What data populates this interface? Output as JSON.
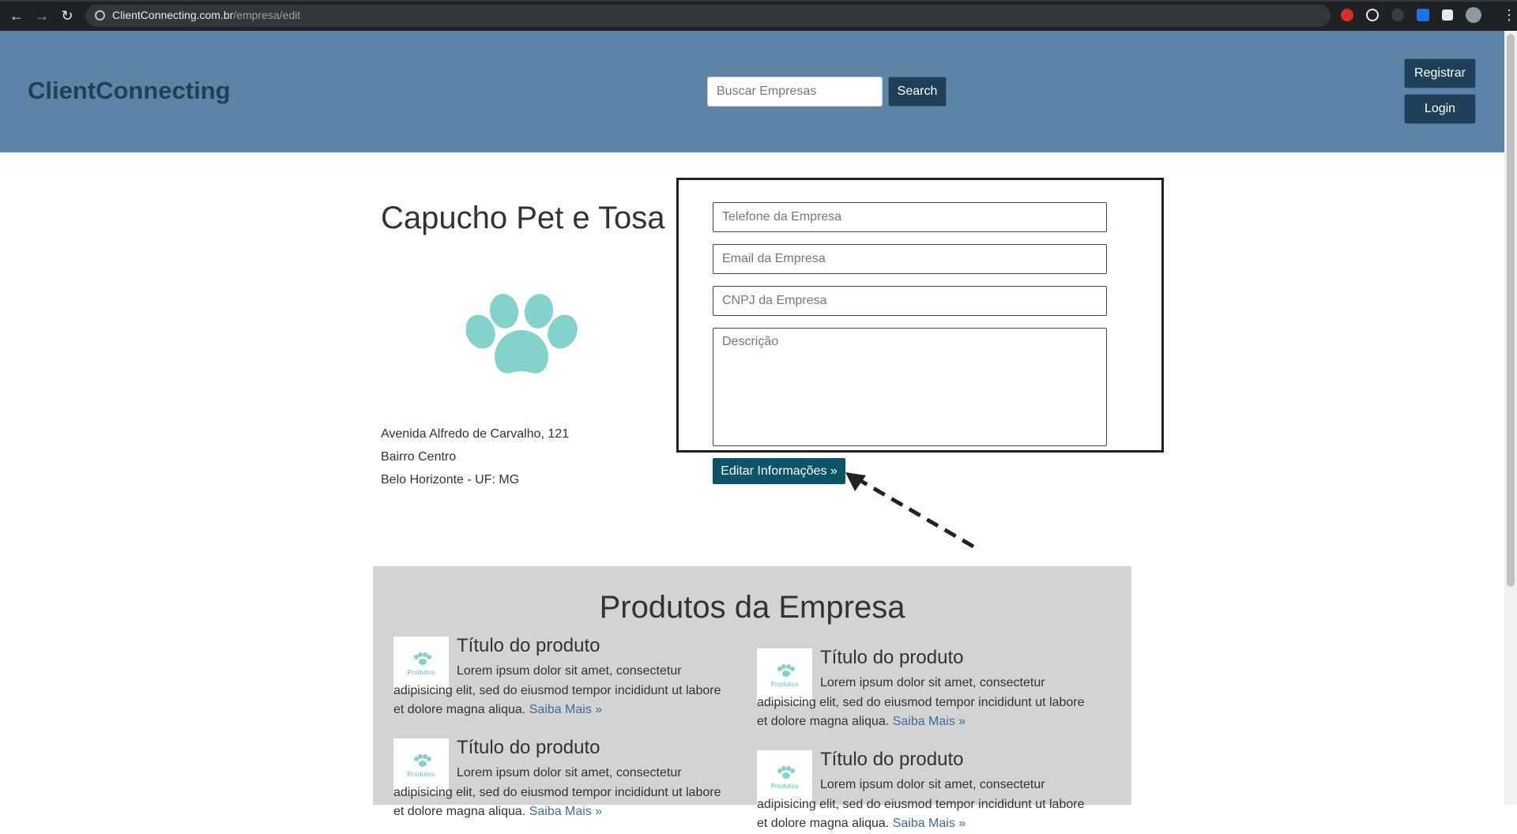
{
  "browser": {
    "url_host": "ClientConnecting.com.br",
    "url_path": "/empresa/edit",
    "back_icon": "arrow-left-icon",
    "forward_icon": "arrow-right-icon",
    "reload_icon": "reload-icon"
  },
  "header": {
    "brand": "ClientConnecting",
    "search_placeholder": "Buscar Empresas",
    "search_label": "Search",
    "register_label": "Registrar",
    "login_label": "Login",
    "colors": {
      "header_bg": "#5c83a8",
      "button_bg": "#1f4158"
    }
  },
  "company": {
    "name": "Capucho Pet e Tosa",
    "logo_icon": "paw-icon",
    "logo_color": "#83d3cb",
    "address_line1": "Avenida Alfredo de Carvalho, 121",
    "address_line2": "Bairro Centro",
    "address_line3": "Belo Horizonte - UF: MG"
  },
  "form": {
    "phone_placeholder": "Telefone da Empresa",
    "email_placeholder": "Email da Empresa",
    "cnpj_placeholder": "CNPJ da Empresa",
    "description_placeholder": "Descrição",
    "submit_label": "Editar Informações »",
    "submit_color": "#0d5468"
  },
  "products": {
    "title": "Produtos da Empresa",
    "thumb_label": "Produtos",
    "items": [
      {
        "title": "Título do produto",
        "text": "Lorem ipsum dolor sit amet, consectetur adipisicing elit, sed do eiusmod tempor incididunt ut labore et dolore magna aliqua.",
        "link": "Saiba Mais »"
      },
      {
        "title": "Título do produto",
        "text": "Lorem ipsum dolor sit amet, consectetur adipisicing elit, sed do eiusmod tempor incididunt ut labore et dolore magna aliqua.",
        "link": "Saiba Mais »"
      },
      {
        "title": "Título do produto",
        "text": "Lorem ipsum dolor sit amet, consectetur adipisicing elit, sed do eiusmod tempor incididunt ut labore et dolore magna aliqua.",
        "link": "Saiba Mais »"
      },
      {
        "title": "Título do produto",
        "text": "Lorem ipsum dolor sit amet, consectetur adipisicing elit, sed do eiusmod tempor incididunt ut labore et dolore magna aliqua.",
        "link": "Saiba Mais »"
      }
    ]
  }
}
